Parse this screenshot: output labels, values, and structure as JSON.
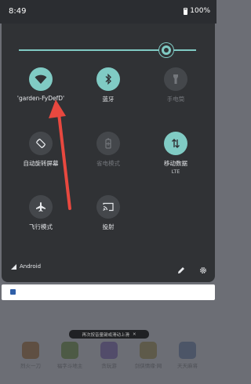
{
  "status_bar": {
    "time": "8:49",
    "battery": "100%"
  },
  "brightness": {
    "level": 0.82
  },
  "tiles": [
    {
      "name": "wifi",
      "label": "'garden-FyDefD'",
      "state": "on",
      "icon": "wifi-icon"
    },
    {
      "name": "bluetooth",
      "label": "蓝牙",
      "state": "on",
      "icon": "bluetooth-icon"
    },
    {
      "name": "flashlight",
      "label": "手电筒",
      "state": "off",
      "icon": "flashlight-icon"
    },
    {
      "name": "auto-rotate",
      "label": "自动旋转屏幕",
      "state": "off-dark",
      "icon": "auto-rotate-icon"
    },
    {
      "name": "battery-saver",
      "label": "省电模式",
      "state": "off",
      "icon": "battery-saver-icon"
    },
    {
      "name": "mobile-data",
      "label": "移动数据",
      "sublabel": "LTE",
      "state": "on",
      "icon": "mobile-data-icon"
    },
    {
      "name": "airplane",
      "label": "飞行模式",
      "state": "off-dark",
      "icon": "airplane-icon"
    },
    {
      "name": "cast",
      "label": "投射",
      "state": "off-dark",
      "icon": "cast-icon"
    }
  ],
  "footer": {
    "carrier": "Android"
  },
  "toast": {
    "text": "再次按音量键或滑动上滑",
    "close": "✕"
  },
  "apps": [
    {
      "label": "烈火一刀"
    },
    {
      "label": "福字斗地主"
    },
    {
      "label": "贪玩游"
    },
    {
      "label": "剑侠情缘·网"
    },
    {
      "label": "天天麻将"
    }
  ],
  "colors": {
    "accent": "#80cbc4",
    "shade": "#303235",
    "arrow": "#e8483f"
  }
}
